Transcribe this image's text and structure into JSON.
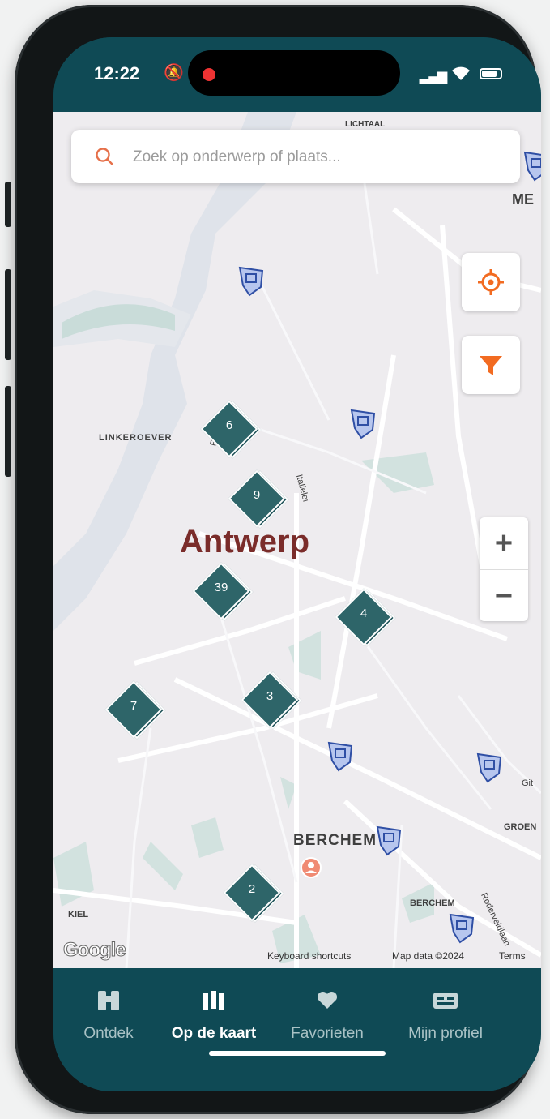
{
  "status_bar": {
    "time": "12:22"
  },
  "search": {
    "placeholder": "Zoek op onderwerp of plaats..."
  },
  "map": {
    "city_label": "Antwerp",
    "place_labels": {
      "lichtaal": "LICHTAAL",
      "me": "ME",
      "linkeroever": "LINKEROEVER",
      "rijnkaai": "Rijnk",
      "italielei": "Italielei",
      "berchem": "BERCHEM",
      "groen": "GROEN",
      "berchem_small": "BERCHEM",
      "roderveldlaan": "Roderveldlaan",
      "kiel": "KIEL",
      "git": "Git"
    },
    "clusters": [
      {
        "label": "6"
      },
      {
        "label": "9"
      },
      {
        "label": "39"
      },
      {
        "label": "4"
      },
      {
        "label": "7"
      },
      {
        "label": "3"
      },
      {
        "label": "2"
      }
    ],
    "zoom": {
      "in": "+",
      "out": "−"
    },
    "attribution": {
      "google": "Google",
      "shortcuts": "Keyboard shortcuts",
      "map_data": "Map data ©2024",
      "terms": "Terms"
    },
    "colors": {
      "accent": "#f26b21",
      "cluster": "#2e6569",
      "pin": "#b7c6ee"
    }
  },
  "nav": {
    "items": [
      {
        "label": "Ontdek",
        "icon": "binoculars-icon",
        "active": false
      },
      {
        "label": "Op de kaart",
        "icon": "map-icon",
        "active": true
      },
      {
        "label": "Favorieten",
        "icon": "heart-icon",
        "active": false
      },
      {
        "label": "Mijn profiel",
        "icon": "id-card-icon",
        "active": false
      }
    ]
  }
}
